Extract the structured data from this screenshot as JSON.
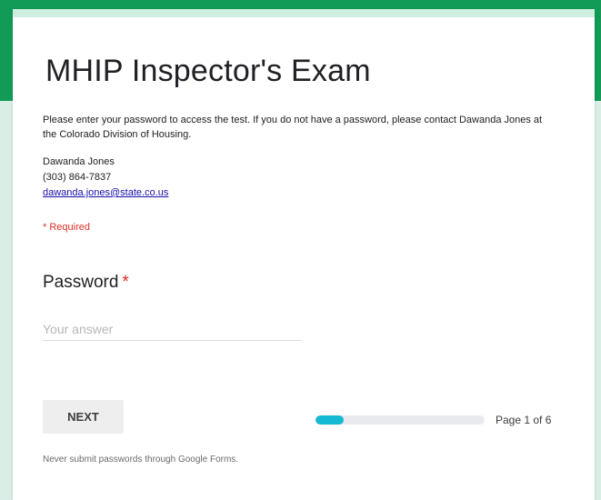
{
  "form": {
    "title": "MHIP Inspector's Exam",
    "description": "Please enter your password to access the test. If you do not have a password, please contact Dawanda Jones at the Colorado Division of Housing.",
    "contact": {
      "name": "Dawanda Jones",
      "phone": "(303) 864-7837",
      "email": "dawanda.jones@state.co.us"
    },
    "required_note": "* Required"
  },
  "question": {
    "label": "Password",
    "required_marker": "*",
    "value": "",
    "placeholder": "Your answer"
  },
  "navigation": {
    "next_label": "NEXT",
    "page_label": "Page 1 of 6",
    "progress_fraction": 0.1667
  },
  "footer": {
    "note": "Never submit passwords through Google Forms."
  },
  "colors": {
    "brand": "#119b56",
    "progress": "#16b9d2",
    "required": "#d93025"
  }
}
